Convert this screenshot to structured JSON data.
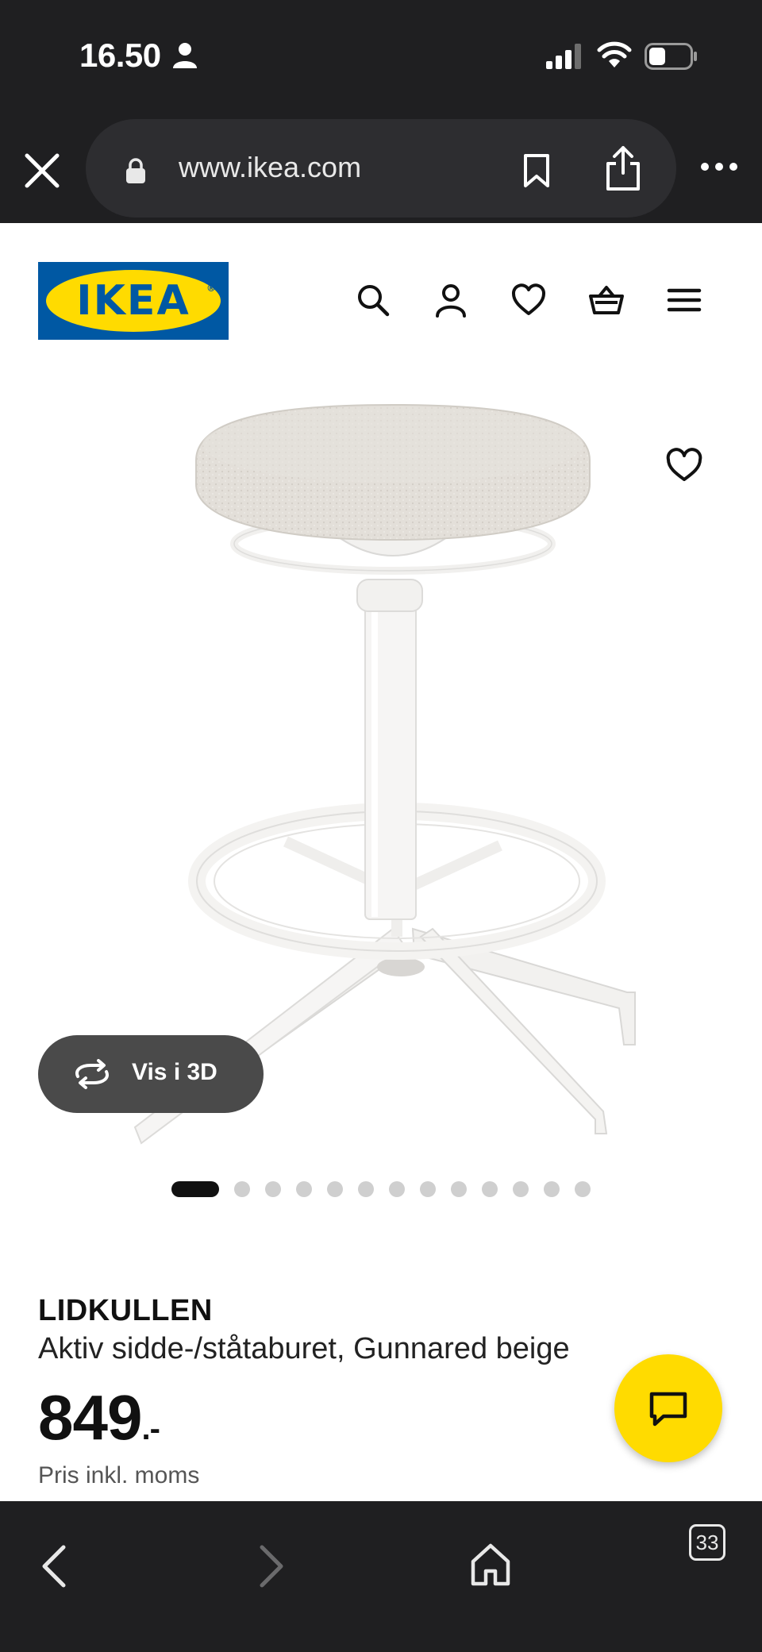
{
  "status_bar": {
    "time": "16.50",
    "icons": [
      "person-icon",
      "signal-icon",
      "wifi-icon",
      "battery-icon"
    ]
  },
  "browser": {
    "url": "www.ikea.com",
    "icons": [
      "close-icon",
      "lock-icon",
      "bookmark-icon",
      "share-icon",
      "more-icon"
    ]
  },
  "header": {
    "logo_text": "IKEA",
    "logo_registered": "®",
    "logo_colors": {
      "blue": "#0058a3",
      "yellow": "#ffdb00"
    },
    "icons": [
      "search-icon",
      "user-icon",
      "heart-icon",
      "basket-icon",
      "menu-icon"
    ]
  },
  "gallery": {
    "vis3d_label": "Vis i 3D",
    "dot_count": 14,
    "active_dot": 1
  },
  "product": {
    "name": "LIDKULLEN",
    "description": "Aktiv sidde-/ståtaburet, Gunnared beige",
    "price": "849",
    "price_suffix": ".-",
    "price_note": "Pris inkl. moms"
  },
  "chat": {
    "color": "#ffdb00"
  },
  "toolbar": {
    "tabs_count": "33",
    "icons": [
      "back-icon",
      "forward-icon",
      "home-icon",
      "tabs-icon"
    ]
  }
}
